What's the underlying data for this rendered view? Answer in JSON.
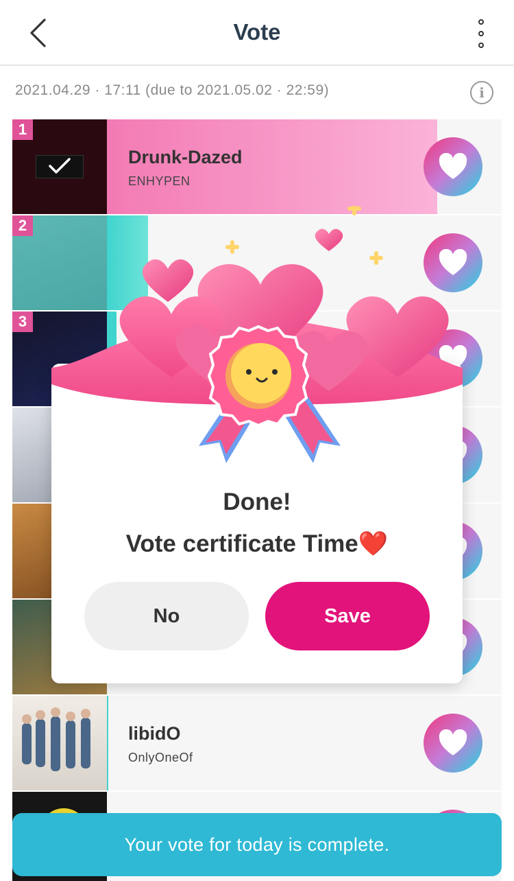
{
  "header": {
    "title": "Vote",
    "back_icon": "chevron-left-icon",
    "more_icon": "more-vertical-icon"
  },
  "date_line": "2021.04.29 · 17:11 (due to 2021.05.02 · 22:59)",
  "info_icon": "info-icon",
  "list": [
    {
      "rank": "1",
      "song": "Drunk-Dazed",
      "artist": "ENHYPEN",
      "progress": 0.7
    },
    {
      "rank": "2",
      "song": "",
      "artist": "",
      "progress": 0.1
    },
    {
      "rank": "3",
      "song": "",
      "artist": "",
      "progress": 0.02
    },
    {
      "rank": "",
      "song": "",
      "artist": "",
      "progress": 0
    },
    {
      "rank": "",
      "song": "",
      "artist": "",
      "progress": 0
    },
    {
      "rank": "",
      "song": "",
      "artist": "",
      "progress": 0
    },
    {
      "rank": "",
      "song": "libidO",
      "artist": "OnlyOneOf",
      "progress": 0.005
    },
    {
      "rank": "",
      "song": "",
      "artist": "",
      "progress": 0
    }
  ],
  "modal": {
    "title": "Done!",
    "subtitle": "Vote certificate Time❤️",
    "no_label": "No",
    "save_label": "Save",
    "badge_icon": "smiley-medal-icon"
  },
  "toast": "Your vote for today is complete.",
  "colors": {
    "accent_pink": "#e2137a",
    "toast_blue": "#2fb9d4",
    "rank_badge": "#e05398"
  }
}
